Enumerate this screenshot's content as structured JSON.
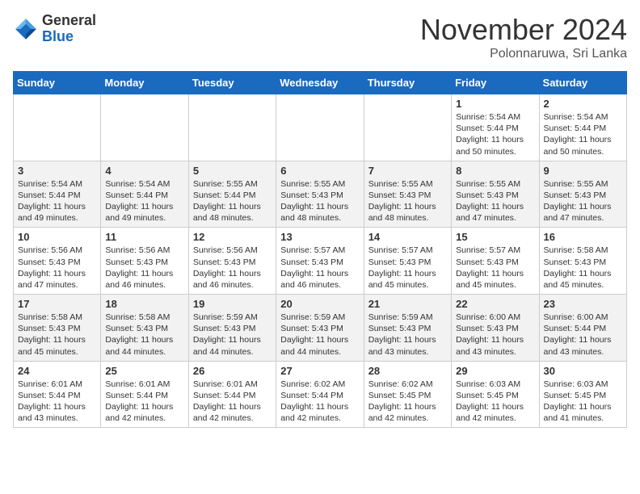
{
  "header": {
    "logo_general": "General",
    "logo_blue": "Blue",
    "month_title": "November 2024",
    "location": "Polonnaruwa, Sri Lanka"
  },
  "weekdays": [
    "Sunday",
    "Monday",
    "Tuesday",
    "Wednesday",
    "Thursday",
    "Friday",
    "Saturday"
  ],
  "weeks": [
    [
      {
        "day": "",
        "info": ""
      },
      {
        "day": "",
        "info": ""
      },
      {
        "day": "",
        "info": ""
      },
      {
        "day": "",
        "info": ""
      },
      {
        "day": "",
        "info": ""
      },
      {
        "day": "1",
        "info": "Sunrise: 5:54 AM\nSunset: 5:44 PM\nDaylight: 11 hours\nand 50 minutes."
      },
      {
        "day": "2",
        "info": "Sunrise: 5:54 AM\nSunset: 5:44 PM\nDaylight: 11 hours\nand 50 minutes."
      }
    ],
    [
      {
        "day": "3",
        "info": "Sunrise: 5:54 AM\nSunset: 5:44 PM\nDaylight: 11 hours\nand 49 minutes."
      },
      {
        "day": "4",
        "info": "Sunrise: 5:54 AM\nSunset: 5:44 PM\nDaylight: 11 hours\nand 49 minutes."
      },
      {
        "day": "5",
        "info": "Sunrise: 5:55 AM\nSunset: 5:44 PM\nDaylight: 11 hours\nand 48 minutes."
      },
      {
        "day": "6",
        "info": "Sunrise: 5:55 AM\nSunset: 5:43 PM\nDaylight: 11 hours\nand 48 minutes."
      },
      {
        "day": "7",
        "info": "Sunrise: 5:55 AM\nSunset: 5:43 PM\nDaylight: 11 hours\nand 48 minutes."
      },
      {
        "day": "8",
        "info": "Sunrise: 5:55 AM\nSunset: 5:43 PM\nDaylight: 11 hours\nand 47 minutes."
      },
      {
        "day": "9",
        "info": "Sunrise: 5:55 AM\nSunset: 5:43 PM\nDaylight: 11 hours\nand 47 minutes."
      }
    ],
    [
      {
        "day": "10",
        "info": "Sunrise: 5:56 AM\nSunset: 5:43 PM\nDaylight: 11 hours\nand 47 minutes."
      },
      {
        "day": "11",
        "info": "Sunrise: 5:56 AM\nSunset: 5:43 PM\nDaylight: 11 hours\nand 46 minutes."
      },
      {
        "day": "12",
        "info": "Sunrise: 5:56 AM\nSunset: 5:43 PM\nDaylight: 11 hours\nand 46 minutes."
      },
      {
        "day": "13",
        "info": "Sunrise: 5:57 AM\nSunset: 5:43 PM\nDaylight: 11 hours\nand 46 minutes."
      },
      {
        "day": "14",
        "info": "Sunrise: 5:57 AM\nSunset: 5:43 PM\nDaylight: 11 hours\nand 45 minutes."
      },
      {
        "day": "15",
        "info": "Sunrise: 5:57 AM\nSunset: 5:43 PM\nDaylight: 11 hours\nand 45 minutes."
      },
      {
        "day": "16",
        "info": "Sunrise: 5:58 AM\nSunset: 5:43 PM\nDaylight: 11 hours\nand 45 minutes."
      }
    ],
    [
      {
        "day": "17",
        "info": "Sunrise: 5:58 AM\nSunset: 5:43 PM\nDaylight: 11 hours\nand 45 minutes."
      },
      {
        "day": "18",
        "info": "Sunrise: 5:58 AM\nSunset: 5:43 PM\nDaylight: 11 hours\nand 44 minutes."
      },
      {
        "day": "19",
        "info": "Sunrise: 5:59 AM\nSunset: 5:43 PM\nDaylight: 11 hours\nand 44 minutes."
      },
      {
        "day": "20",
        "info": "Sunrise: 5:59 AM\nSunset: 5:43 PM\nDaylight: 11 hours\nand 44 minutes."
      },
      {
        "day": "21",
        "info": "Sunrise: 5:59 AM\nSunset: 5:43 PM\nDaylight: 11 hours\nand 43 minutes."
      },
      {
        "day": "22",
        "info": "Sunrise: 6:00 AM\nSunset: 5:43 PM\nDaylight: 11 hours\nand 43 minutes."
      },
      {
        "day": "23",
        "info": "Sunrise: 6:00 AM\nSunset: 5:44 PM\nDaylight: 11 hours\nand 43 minutes."
      }
    ],
    [
      {
        "day": "24",
        "info": "Sunrise: 6:01 AM\nSunset: 5:44 PM\nDaylight: 11 hours\nand 43 minutes."
      },
      {
        "day": "25",
        "info": "Sunrise: 6:01 AM\nSunset: 5:44 PM\nDaylight: 11 hours\nand 42 minutes."
      },
      {
        "day": "26",
        "info": "Sunrise: 6:01 AM\nSunset: 5:44 PM\nDaylight: 11 hours\nand 42 minutes."
      },
      {
        "day": "27",
        "info": "Sunrise: 6:02 AM\nSunset: 5:44 PM\nDaylight: 11 hours\nand 42 minutes."
      },
      {
        "day": "28",
        "info": "Sunrise: 6:02 AM\nSunset: 5:45 PM\nDaylight: 11 hours\nand 42 minutes."
      },
      {
        "day": "29",
        "info": "Sunrise: 6:03 AM\nSunset: 5:45 PM\nDaylight: 11 hours\nand 42 minutes."
      },
      {
        "day": "30",
        "info": "Sunrise: 6:03 AM\nSunset: 5:45 PM\nDaylight: 11 hours\nand 41 minutes."
      }
    ]
  ]
}
